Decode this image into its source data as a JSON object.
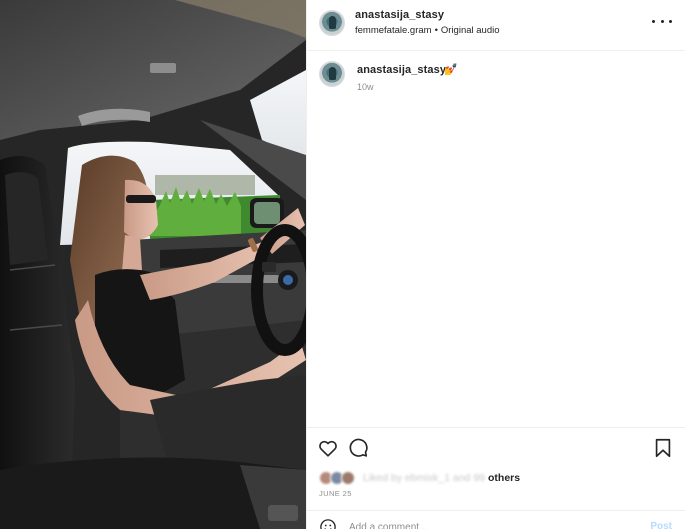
{
  "post": {
    "author": "anastasija_stasy",
    "audio_account": "femmefatale.gram",
    "audio_separator": "•",
    "audio_label": "Original audio"
  },
  "caption": {
    "username": "anastasija_stasy",
    "emoji": "💅",
    "time_ago": "10w"
  },
  "likes": {
    "liked_by_text": "Liked by ebmixk_1 and 99",
    "others_label": "others",
    "date": "JUNE 25"
  },
  "comment_box": {
    "placeholder": "Add a comment...",
    "post_label": "Post"
  },
  "icons": {
    "more": "more-options-icon",
    "like": "heart-icon",
    "comment": "speech-bubble-icon",
    "save": "bookmark-icon",
    "emoji": "smiley-icon"
  },
  "colors": {
    "text": "#262626",
    "secondary": "#8e8e8e",
    "post_button_disabled": "#b3dbff",
    "divider": "#efefef"
  }
}
